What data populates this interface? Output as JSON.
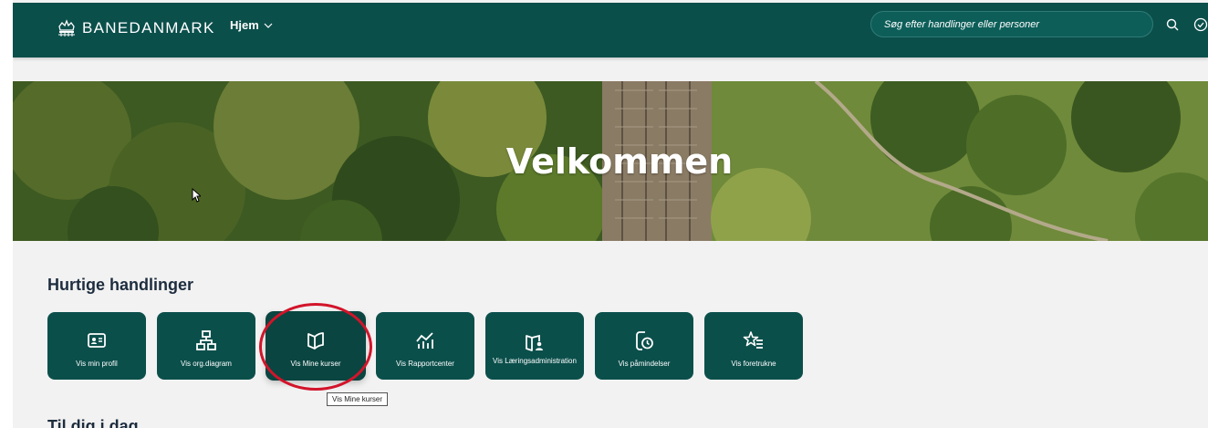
{
  "header": {
    "brand": "BANEDANMARK",
    "nav_home": "Hjem",
    "search_placeholder": "Søg efter handlinger eller personer"
  },
  "hero": {
    "title": "Velkommen"
  },
  "quick_actions": {
    "title": "Hurtige handlinger",
    "tiles": [
      {
        "label": "Vis min profil",
        "icon": "profile-card-icon"
      },
      {
        "label": "Vis org.diagram",
        "icon": "org-chart-icon"
      },
      {
        "label": "Vis Mine kurser",
        "icon": "open-book-icon"
      },
      {
        "label": "Vis Rapportcenter",
        "icon": "line-chart-icon"
      },
      {
        "label": "Vis Læringsadministration",
        "icon": "learning-admin-icon"
      },
      {
        "label": "Vis påmindelser",
        "icon": "reminder-clock-icon"
      },
      {
        "label": "Vis foretrukne",
        "icon": "favorite-star-list-icon"
      }
    ]
  },
  "tooltip": "Vis Mine kurser",
  "next_section": {
    "title": "Til dig i dag"
  },
  "colors": {
    "header_bg": "#0b4f4b",
    "tile_bg": "#0b4f4b",
    "highlight_ring": "#d2142a",
    "page_bg": "#f2f2f2"
  }
}
